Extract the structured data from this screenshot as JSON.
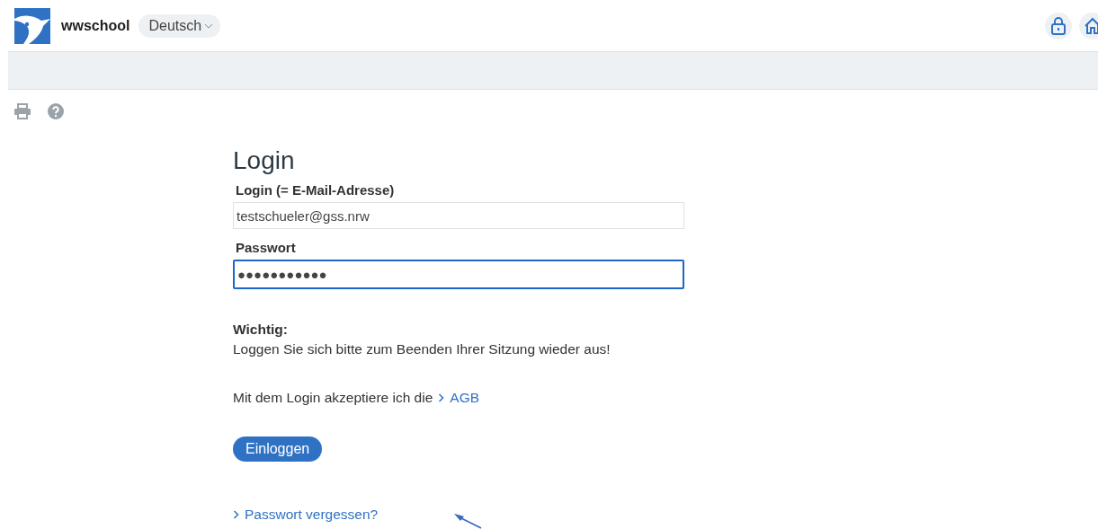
{
  "header": {
    "brand": "wwschool",
    "language": "Deutsch"
  },
  "title": "Login",
  "fields": [
    {
      "label": "Login (= E-Mail-Adresse)",
      "value": "testschueler@gss.nrw",
      "focused": false
    },
    {
      "label": "Passwort",
      "value": "●●●●●●●●●●●",
      "focused": true
    }
  ],
  "notice": {
    "heading": "Wichtig:",
    "text": "Loggen Sie sich bitte zum Beenden Ihrer Sitzung wieder aus!"
  },
  "terms": {
    "text": "Mit dem Login akzeptiere ich die",
    "link": "AGB"
  },
  "submit": "Einloggen",
  "forgot_link": "Passwort vergessen?"
}
